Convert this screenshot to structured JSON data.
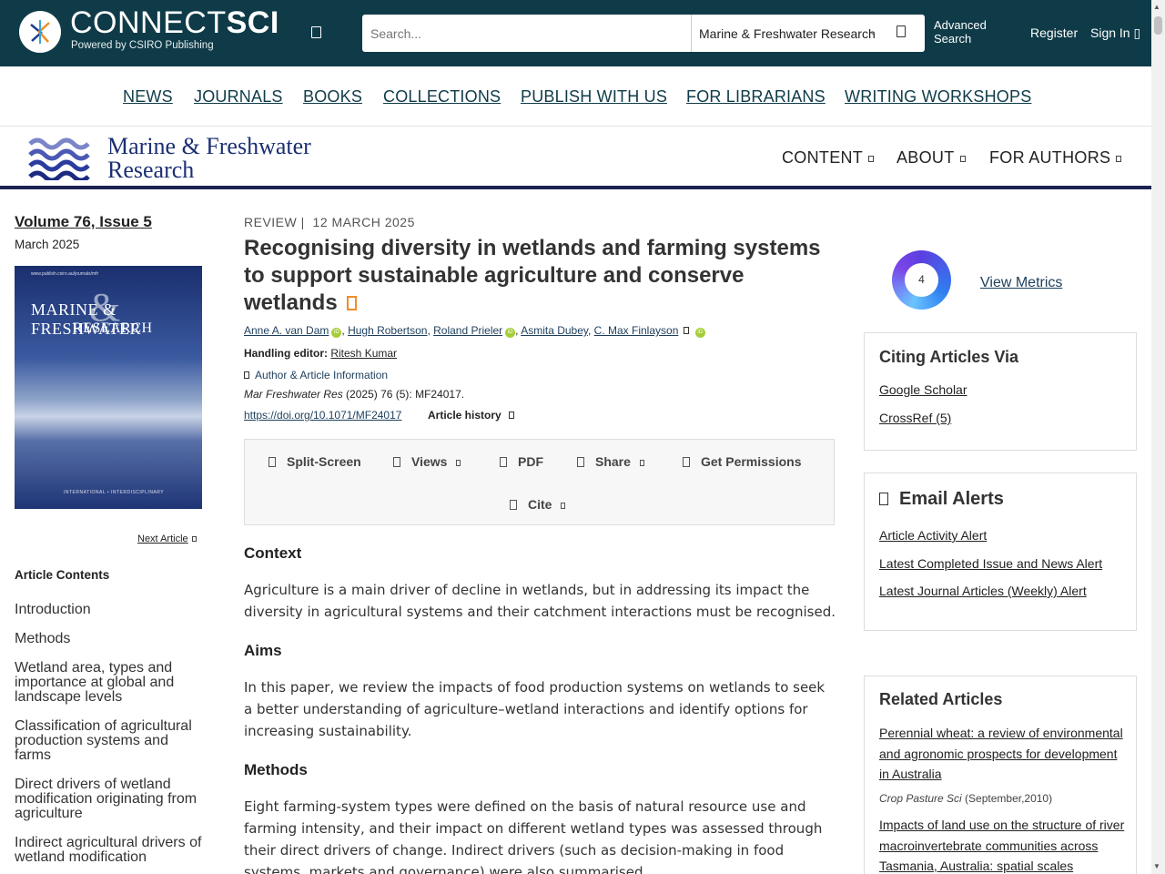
{
  "header": {
    "brand_light": "CONNECT",
    "brand_bold": "SCI",
    "brand_sub": "Powered by CSIRO Publishing",
    "search_placeholder": "Search...",
    "search_scope": "Marine & Freshwater Research",
    "advanced_search_line1": "Advanced",
    "advanced_search_line2": "Search",
    "register": "Register",
    "sign_in": "Sign In"
  },
  "main_nav": [
    "NEWS",
    "JOURNALS",
    "BOOKS",
    "COLLECTIONS",
    "PUBLISH WITH US",
    "FOR LIBRARIANS",
    "WRITING WORKSHOPS"
  ],
  "journal": {
    "name_line1": "Marine & Freshwater",
    "name_line2": "Research",
    "menu": [
      "CONTENT",
      "ABOUT",
      "FOR AUTHORS"
    ],
    "logo_color": "#2b3b9e"
  },
  "sidebar": {
    "volume": "Volume 76, Issue 5",
    "date": "March 2025",
    "cover_title1": "MARINE & FRESHWATER",
    "cover_title2": "RESEARCH",
    "cover_url": "www.publish.csiro.au/journals/mfr",
    "cover_footer": "INTERNATIONAL • INTERDISCIPLINARY",
    "next_article": "Next Article",
    "contents_title": "Article Contents",
    "contents": [
      "Introduction",
      "Methods",
      "Wetland area, types and importance at global and landscape levels",
      "Classification of agricultural production systems and farms",
      "Direct drivers of wetland modification originating from agriculture",
      "Indirect agricultural drivers of wetland modification"
    ]
  },
  "article": {
    "type": "REVIEW",
    "date": "12 MARCH 2025",
    "title": "Recognising diversity in wetlands and farming systems to support sustainable agriculture and conserve wetlands",
    "authors": [
      "Anne A. van Dam",
      "Hugh Robertson",
      "Roland Prieler",
      "Asmita Dubey",
      "C. Max Finlayson"
    ],
    "handling_label": "Handling editor:",
    "handling_editor": "Ritesh Kumar",
    "author_info": "Author & Article Information",
    "citation_journal": "Mar Freshwater Res",
    "citation_rest": "(2025) 76 (5): MF24017.",
    "doi": "https://doi.org/10.1071/MF24017",
    "history": "Article history",
    "toolbar": [
      "Split-Screen",
      "Views",
      "PDF",
      "Share",
      "Get Permissions",
      "Cite"
    ],
    "sections": [
      {
        "heading": "Context",
        "text": "Agriculture is a main driver of decline in wetlands, but in addressing its impact the diversity in agricultural systems and their catchment interactions must be recognised."
      },
      {
        "heading": "Aims",
        "text": "In this paper, we review the impacts of food production systems on wetlands to seek a better understanding of agriculture–wetland interactions and identify options for increasing sustainability."
      },
      {
        "heading": "Methods",
        "text": "Eight farming-system types were defined on the basis of natural resource use and farming intensity, and their impact on different wetland types was assessed through their direct drivers of change. Indirect drivers (such as decision-making in food systems, markets and governance) were also summarised."
      }
    ]
  },
  "right": {
    "altmetric_score": "4",
    "view_metrics": "View Metrics",
    "citing_title": "Citing Articles Via",
    "citing_links": [
      "Google Scholar",
      "CrossRef (5)"
    ],
    "alerts_title": "Email Alerts",
    "alerts": [
      "Article Activity Alert",
      "Latest Completed Issue and News Alert",
      "Latest Journal Articles (Weekly) Alert"
    ],
    "related_title": "Related Articles",
    "related": [
      {
        "title": "Perennial wheat: a review of environmental and agronomic prospects for development in Australia",
        "journal": "Crop Pasture Sci",
        "date": "(September,2010)"
      },
      {
        "title": "Impacts of land use on the structure of river macroinvertebrate communities across Tasmania, Australia: spatial scales"
      }
    ]
  }
}
